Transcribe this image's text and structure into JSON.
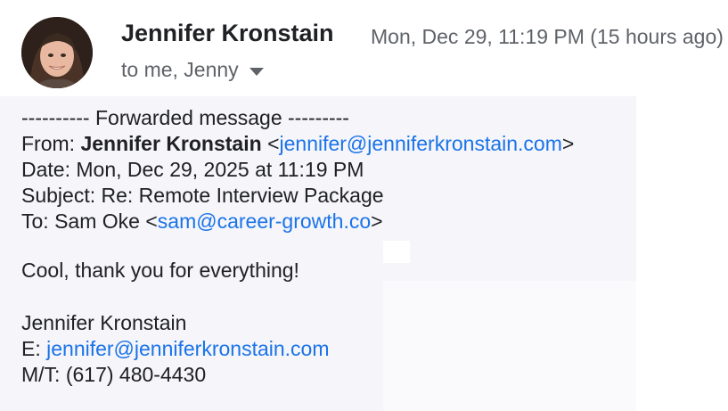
{
  "header": {
    "sender_name": "Jennifer Kronstain",
    "timestamp": "Mon, Dec 29, 11:19 PM (15 hours ago)",
    "recipients": "to me, Jenny",
    "avatar_icon": "profile-photo"
  },
  "forwarded": {
    "divider": "---------- Forwarded message ---------",
    "from_label": "From:",
    "from_name": "Jennifer Kronstain",
    "from_email": "jennifer@jenniferkronstain.com",
    "date_label": "Date:",
    "date_value": "Mon, Dec 29, 2025 at 11:19 PM",
    "subject_label": "Subject:",
    "subject_value": "Re: Remote Interview Package",
    "to_label": "To:",
    "to_name": "Sam Oke",
    "to_email": "sam@career-growth.co"
  },
  "message": {
    "body": "Cool, thank you for everything!",
    "sig_name": "Jennifer Kronstain",
    "sig_email_label": "E:",
    "sig_email": "jennifer@jenniferkronstain.com",
    "sig_phone": "M/T: (617) 480-4430"
  },
  "colors": {
    "link": "#1a73e8",
    "meta_text": "#5f6368",
    "body_bg": "#f5f5fa"
  }
}
